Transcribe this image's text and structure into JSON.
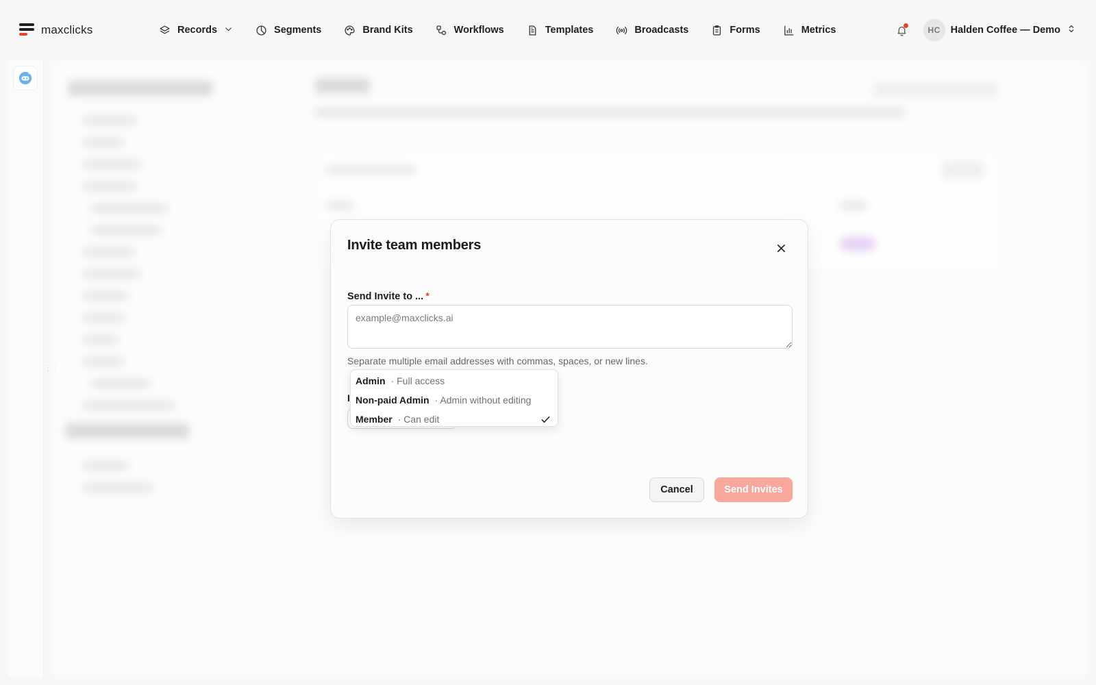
{
  "brand": {
    "name": "maxclicks",
    "accent": "#e8462f"
  },
  "nav": {
    "items": [
      {
        "label": "Records",
        "icon": "layers-icon",
        "has_dropdown": true
      },
      {
        "label": "Segments",
        "icon": "pie-chart-icon"
      },
      {
        "label": "Brand Kits",
        "icon": "palette-icon"
      },
      {
        "label": "Workflows",
        "icon": "workflow-icon"
      },
      {
        "label": "Templates",
        "icon": "document-icon"
      },
      {
        "label": "Broadcasts",
        "icon": "broadcast-icon"
      },
      {
        "label": "Forms",
        "icon": "clipboard-icon"
      },
      {
        "label": "Metrics",
        "icon": "bar-chart-icon"
      }
    ],
    "notifications": {
      "icon": "bell-icon",
      "has_unread": true
    },
    "account": {
      "initials": "HC",
      "name": "Halden Coffee — Demo",
      "icon": "chevron-updown-icon"
    }
  },
  "rail": {
    "icon": "robot-icon"
  },
  "modal": {
    "title": "Invite team members",
    "close_icon": "close-icon",
    "email_label": "Send Invite to ...",
    "required_mark": "*",
    "email_value": "",
    "email_placeholder": "example@maxclicks.ai",
    "helper": "Separate multiple email addresses with commas, spaces, or new lines.",
    "role_label_visible": "I",
    "roles": [
      {
        "name": "Admin",
        "description": "· Full access",
        "selected": false
      },
      {
        "name": "Non-paid Admin",
        "description": "· Admin without editing",
        "selected": false
      },
      {
        "name": "Member",
        "description": "· Can edit",
        "selected": true
      }
    ],
    "cancel_label": "Cancel",
    "send_label": "Send Invites",
    "send_color": "#f8a79a"
  }
}
